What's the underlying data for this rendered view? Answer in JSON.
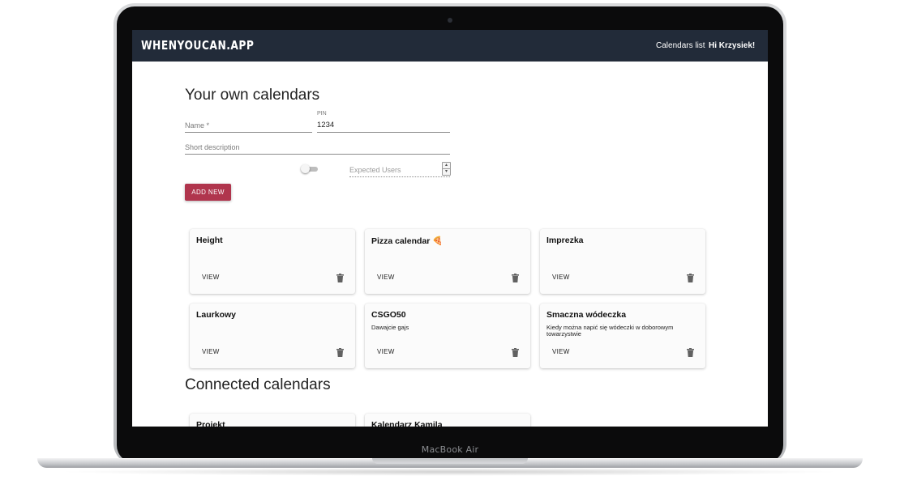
{
  "device": {
    "label": "MacBook Air"
  },
  "navbar": {
    "logo": "WHENYOUCAN.APP",
    "calendars_link": "Calendars list",
    "greeting": "Hi Krzysiek!"
  },
  "own_section": {
    "title": "Your own calendars",
    "form": {
      "name_label": "Name *",
      "pin_label": "PIN",
      "pin_value": "1234",
      "description_label": "Short description",
      "expected_users_label": "Expected Users",
      "toggle_on": false,
      "add_button": "ADD NEW"
    },
    "cards": [
      {
        "title": "Height",
        "description": "",
        "view": "VIEW"
      },
      {
        "title": "Pizza calendar 🍕",
        "description": "",
        "view": "VIEW"
      },
      {
        "title": "Imprezka",
        "description": "",
        "view": "VIEW"
      },
      {
        "title": "Laurkowy",
        "description": "",
        "view": "VIEW"
      },
      {
        "title": "CSGO50",
        "description": "Dawajcie gajs",
        "view": "VIEW"
      },
      {
        "title": "Smaczna wódeczka",
        "description": "Kiedy można napić się wódeczki w doborowym towarzystwie",
        "view": "VIEW"
      }
    ]
  },
  "connected_section": {
    "title": "Connected calendars",
    "cards": [
      {
        "title": "Projekt"
      },
      {
        "title": "Kalendarz Kamila"
      }
    ]
  },
  "icons": {
    "trash": "trash-icon",
    "spinner_up": "chevron-up-icon",
    "spinner_down": "chevron-down-icon"
  },
  "colors": {
    "navbar": "#222b39",
    "accent_button": "#b0354d"
  }
}
